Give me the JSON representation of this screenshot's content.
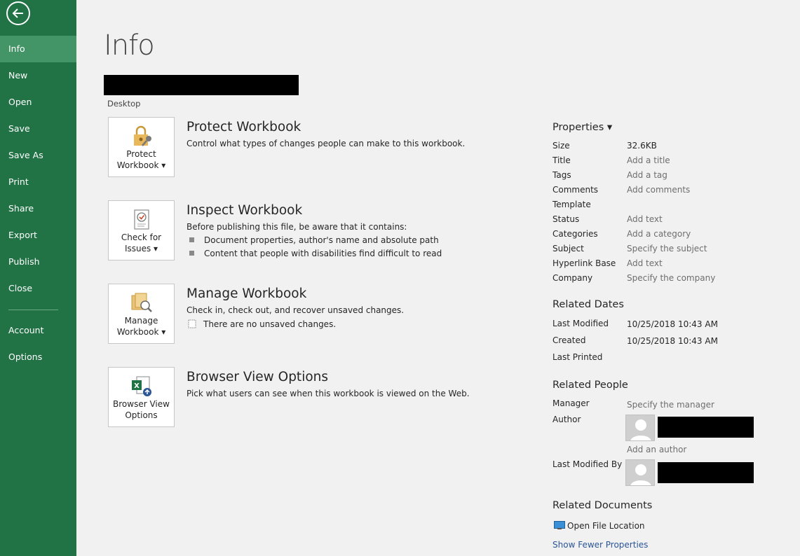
{
  "sidebar": {
    "items": [
      {
        "label": "Info"
      },
      {
        "label": "New"
      },
      {
        "label": "Open"
      },
      {
        "label": "Save"
      },
      {
        "label": "Save As"
      },
      {
        "label": "Print"
      },
      {
        "label": "Share"
      },
      {
        "label": "Export"
      },
      {
        "label": "Publish"
      },
      {
        "label": "Close"
      },
      {
        "label": "Account"
      },
      {
        "label": "Options"
      }
    ],
    "active": "Info"
  },
  "page": {
    "title": "Info",
    "location": "Desktop"
  },
  "sections": [
    {
      "button_label": "Protect\nWorkbook ▾",
      "icon": "lock-key-icon",
      "title": "Protect Workbook",
      "description": "Control what types of changes people can make to this workbook."
    },
    {
      "button_label": "Check for\nIssues ▾",
      "icon": "inspect-document-icon",
      "title": "Inspect Workbook",
      "description": "Before publishing this file, be aware that it contains:",
      "bullets": [
        "Document properties, author's name and absolute path",
        "Content that people with disabilities find difficult to read"
      ]
    },
    {
      "button_label": "Manage\nWorkbook ▾",
      "icon": "manage-versions-icon",
      "title": "Manage Workbook",
      "description": "Check in, check out, and recover unsaved changes.",
      "note": "There are no unsaved changes."
    },
    {
      "button_label": "Browser View\nOptions",
      "icon": "excel-web-icon",
      "title": "Browser View Options",
      "description": "Pick what users can see when this workbook is viewed on the Web."
    }
  ],
  "properties": {
    "header": "Properties ▾",
    "rows": [
      {
        "label": "Size",
        "value": "32.6KB",
        "hint": false
      },
      {
        "label": "Title",
        "value": "Add a title",
        "hint": true
      },
      {
        "label": "Tags",
        "value": "Add a tag",
        "hint": true
      },
      {
        "label": "Comments",
        "value": "Add comments",
        "hint": true
      },
      {
        "label": "Template",
        "value": "",
        "hint": false
      },
      {
        "label": "Status",
        "value": "Add text",
        "hint": true
      },
      {
        "label": "Categories",
        "value": "Add a category",
        "hint": true
      },
      {
        "label": "Subject",
        "value": "Specify the subject",
        "hint": true
      },
      {
        "label": "Hyperlink Base",
        "value": "Add text",
        "hint": true
      },
      {
        "label": "Company",
        "value": "Specify the company",
        "hint": true
      }
    ]
  },
  "related_dates": {
    "header": "Related Dates",
    "rows": [
      {
        "label": "Last Modified",
        "value": "10/25/2018 10:43 AM"
      },
      {
        "label": "Created",
        "value": "10/25/2018 10:43 AM"
      },
      {
        "label": "Last Printed",
        "value": ""
      }
    ]
  },
  "related_people": {
    "header": "Related People",
    "manager_label": "Manager",
    "manager_value": "Specify the manager",
    "author_label": "Author",
    "add_author": "Add an author",
    "last_modified_by_label": "Last Modified By"
  },
  "related_documents": {
    "header": "Related Documents",
    "open_file_location": "Open File Location",
    "show_fewer": "Show Fewer Properties"
  },
  "colors": {
    "sidebar": "#217346",
    "sidebar_active": "#439467",
    "link": "#2a5597"
  }
}
